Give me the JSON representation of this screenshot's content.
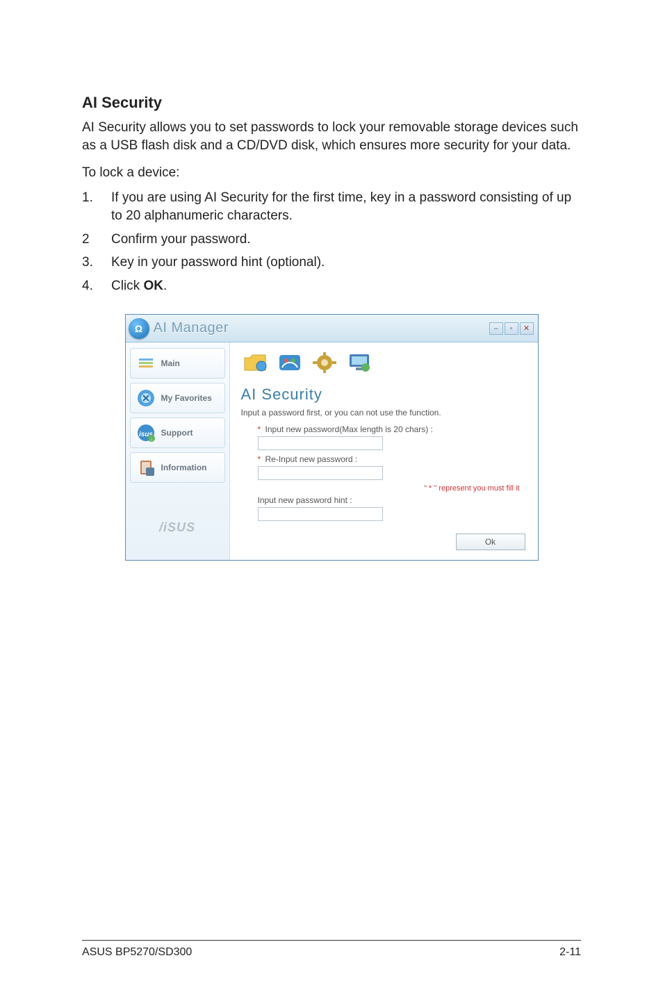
{
  "section": {
    "title": "AI Security",
    "intro": "AI Security allows you to set passwords to lock your removable storage devices such as a USB flash disk and a CD/DVD disk, which ensures more security for your data.",
    "lock_intro": "To lock a device:",
    "steps": [
      {
        "num": "1.",
        "text": "If you are using AI Security for the first time, key in a password consisting of up to 20 alphanumeric characters."
      },
      {
        "num": "2",
        "text": "Confirm your password."
      },
      {
        "num": "3.",
        "text": "Key in your password hint (optional)."
      },
      {
        "num": "4.",
        "text_prefix": "Click ",
        "bold": "OK",
        "text_suffix": "."
      }
    ]
  },
  "app": {
    "title": "AI Manager",
    "logo_glyph": "Ω",
    "win_min": "–",
    "win_max": "▫",
    "win_close": "✕",
    "sidebar": {
      "items": [
        {
          "label": "Main"
        },
        {
          "label": "My Favorites"
        },
        {
          "label": "Support"
        },
        {
          "label": "Information"
        }
      ],
      "brand": "/‎iSUS"
    },
    "toolbar_icons": [
      "folder-icon",
      "meter-icon",
      "gear-icon",
      "monitor-icon"
    ],
    "panel": {
      "title": "AI Security",
      "subtitle": "Input a password first, or you can not use the function.",
      "field1_label": "Input new password(Max length is 20 chars) :",
      "field2_label": "Re-Input new password :",
      "hint_note": "\" * \" represent you must fill it",
      "field3_label": "Input new password hint :",
      "ok_label": "Ok"
    }
  },
  "footer": {
    "left": "ASUS BP5270/SD300",
    "right": "2-11"
  }
}
